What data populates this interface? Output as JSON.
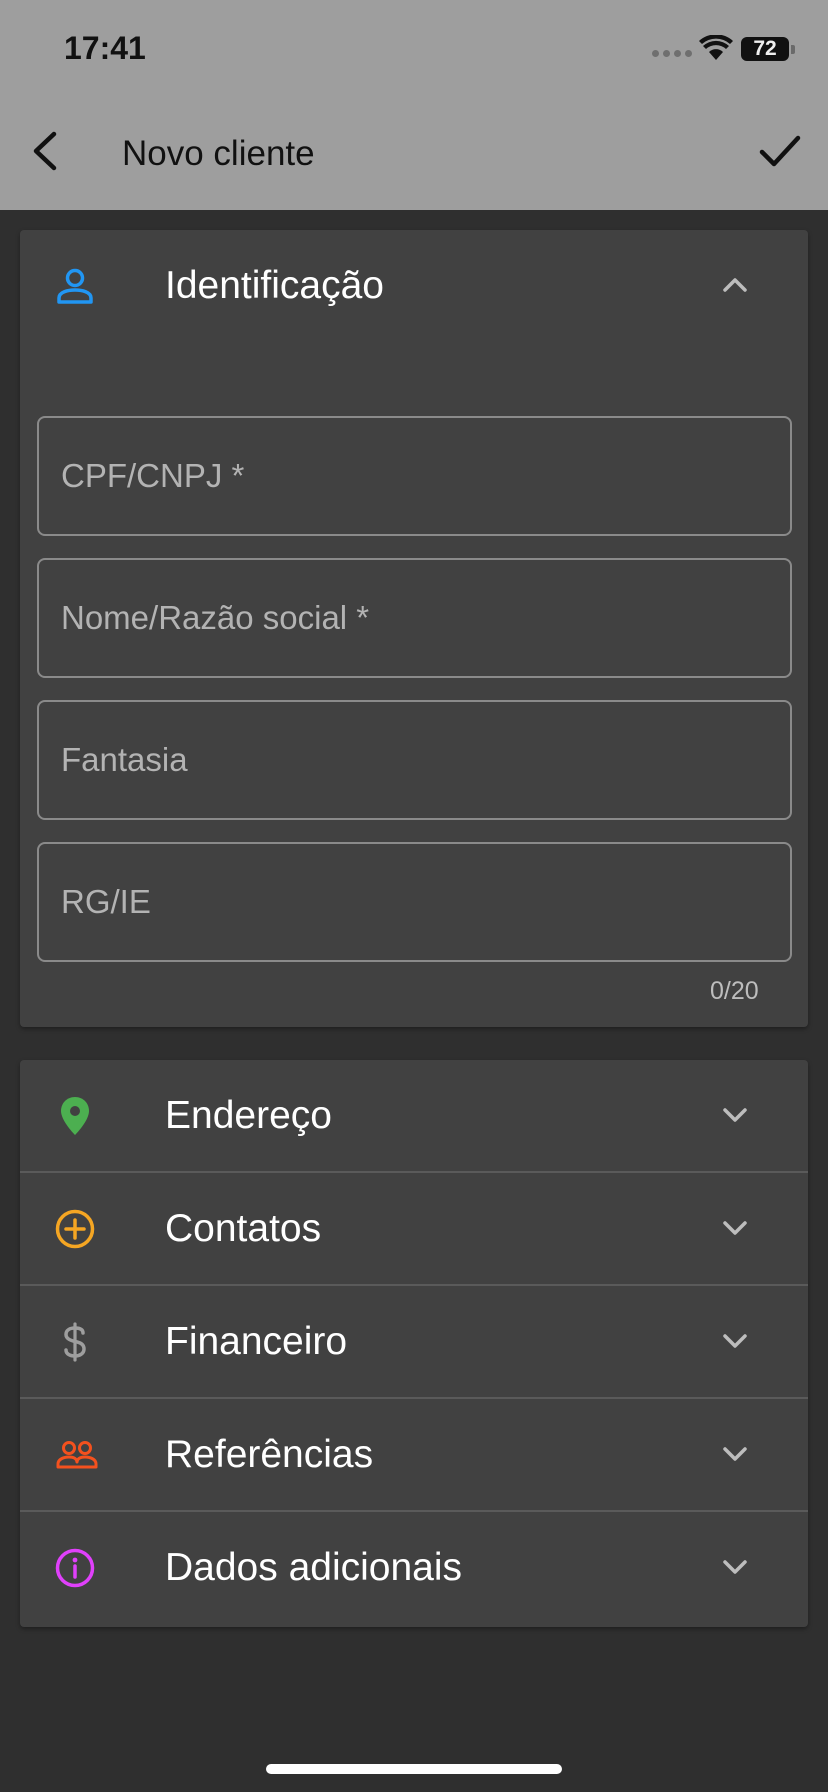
{
  "status_bar": {
    "time": "17:41",
    "battery": "72"
  },
  "app_bar": {
    "title": "Novo cliente"
  },
  "identificacao": {
    "label": "Identificação",
    "fields": [
      {
        "placeholder": "CPF/CNPJ *",
        "value": ""
      },
      {
        "placeholder": "Nome/Razão social *",
        "value": ""
      },
      {
        "placeholder": "Fantasia",
        "value": ""
      },
      {
        "placeholder": "RG/IE",
        "value": ""
      }
    ],
    "counter": "0/20"
  },
  "sections": [
    {
      "label": "Endereço",
      "icon": "location-pin-icon",
      "color": "#4caf50"
    },
    {
      "label": "Contatos",
      "icon": "add-circle-icon",
      "color": "#f5a623"
    },
    {
      "label": "Financeiro",
      "icon": "dollar-icon",
      "color": "#9e9e9e"
    },
    {
      "label": "Referências",
      "icon": "people-icon",
      "color": "#f4511e"
    },
    {
      "label": "Dados adicionais",
      "icon": "info-icon",
      "color": "#e040fb"
    }
  ],
  "colors": {
    "app_bar": "#9e9e9e",
    "card": "#414141",
    "background": "#2f2f2f",
    "identificacao_icon": "#2196f3"
  }
}
